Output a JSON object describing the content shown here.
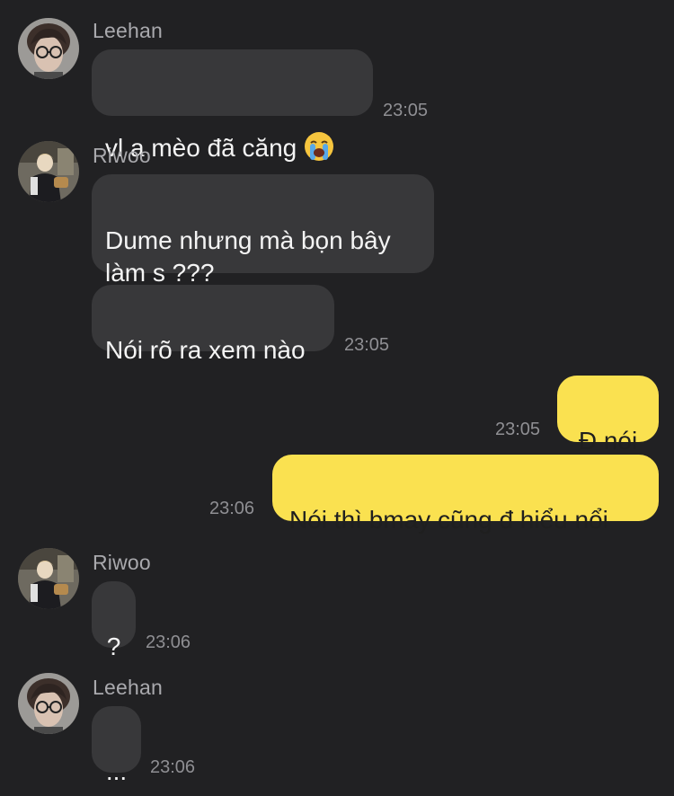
{
  "messages": [
    {
      "sender": "Leehan",
      "avatar_icon": "leehan-avatar",
      "text": "vl a mèo đã căng",
      "emoji": "loudly-crying-face-icon",
      "time": "23:05"
    },
    {
      "sender": "Riwoo",
      "avatar_icon": "riwoo-avatar",
      "text": "Dume nhưng mà bọn bây\nlàm s ???",
      "time": ""
    },
    {
      "sender": "Riwoo",
      "text": "Nói rõ ra xem nào",
      "time": "23:05"
    },
    {
      "sender": "me",
      "text": "Đ nói",
      "time": "23:05"
    },
    {
      "sender": "me",
      "text": "Nói thì bmay cũng đ hiểu nổi",
      "time": "23:06"
    },
    {
      "sender": "Riwoo",
      "avatar_icon": "riwoo-avatar",
      "text": "?",
      "time": "23:06"
    },
    {
      "sender": "Leehan",
      "avatar_icon": "leehan-avatar",
      "text": "...",
      "time": "23:06"
    }
  ],
  "colors": {
    "background": "#212123",
    "incoming_bubble": "#38383a",
    "outgoing_bubble": "#fae150",
    "incoming_text": "#f4f4f4",
    "outgoing_text": "#1f1f1f",
    "meta_text": "#8f8f93"
  }
}
